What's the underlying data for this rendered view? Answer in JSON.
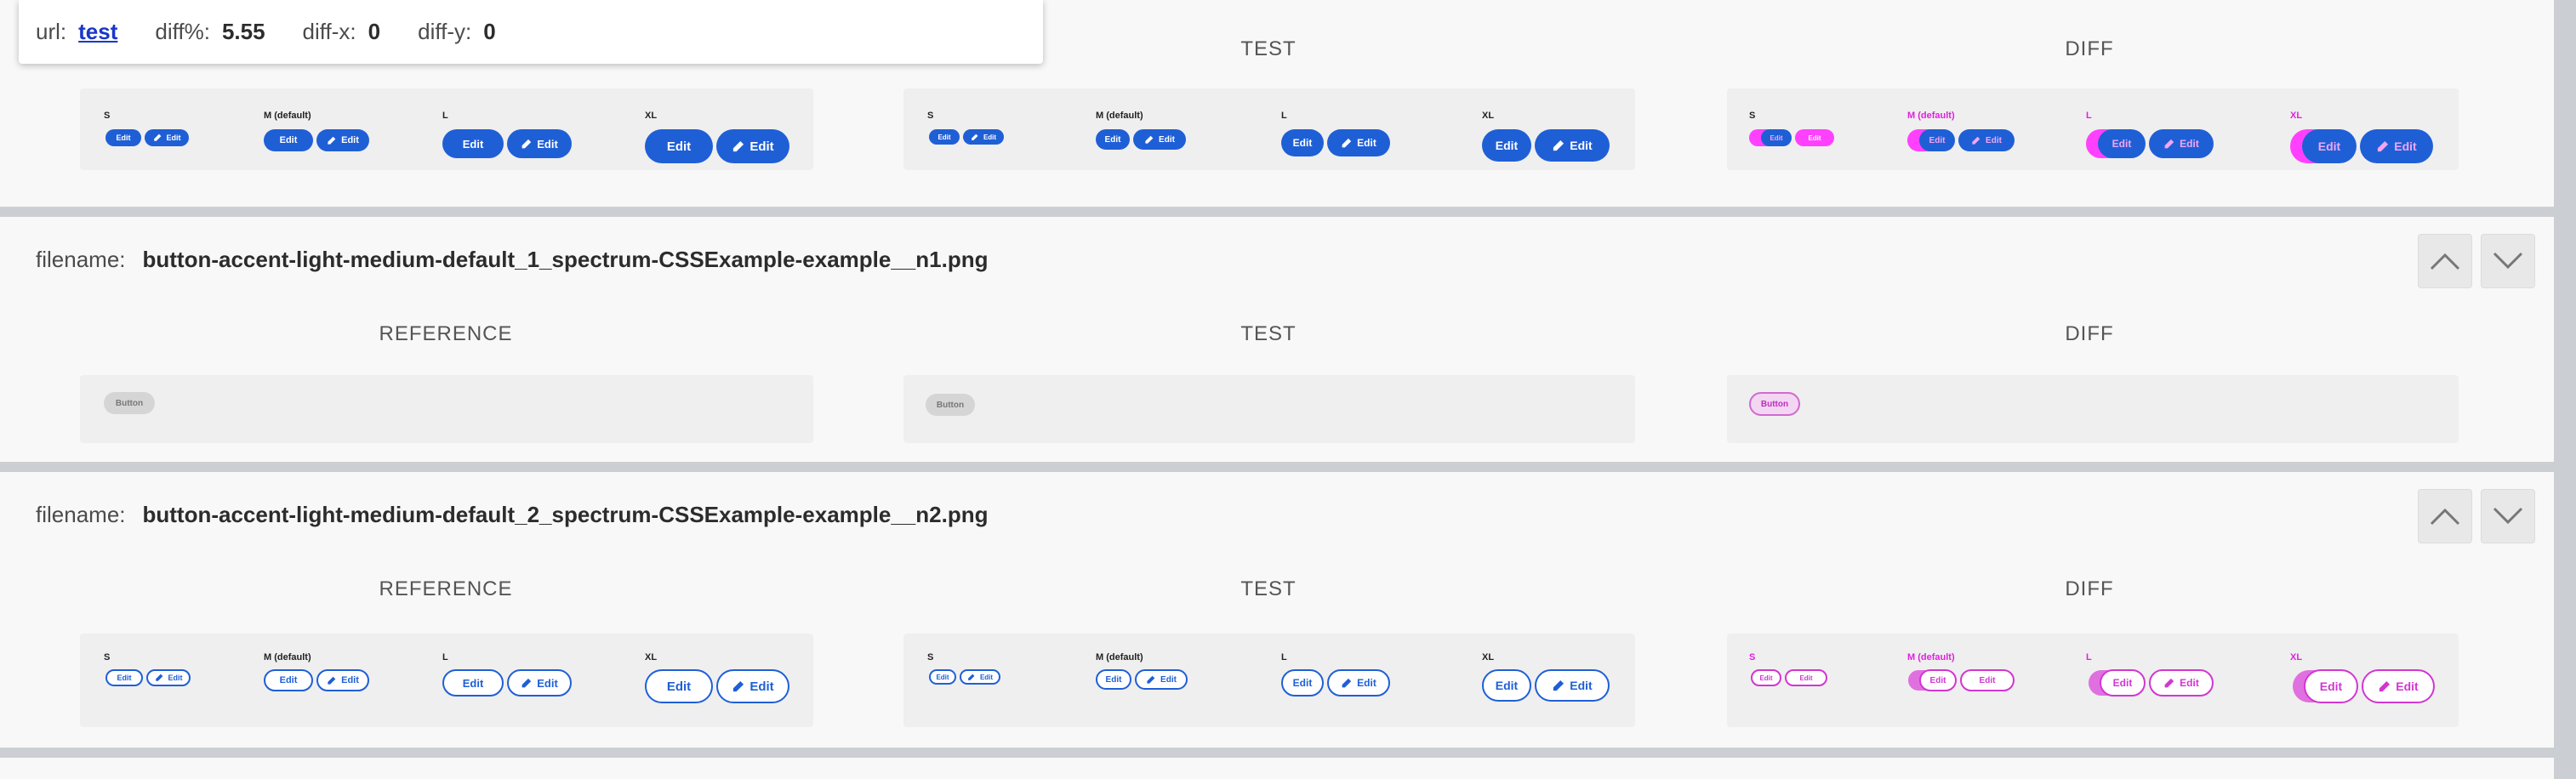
{
  "overlay": {
    "url_label": "url:",
    "url_link": "test",
    "diff_label": "diff%:",
    "diff_value": "5.55",
    "diffx_label": "diff-x:",
    "diffx_value": "0",
    "diffy_label": "diff-y:",
    "diffy_value": "0"
  },
  "headings": {
    "reference": "REFERENCE",
    "test": "TEST",
    "diff": "DIFF"
  },
  "sizes": {
    "s": "S",
    "m": "M (default)",
    "l": "L",
    "xl": "XL"
  },
  "button_labels": {
    "edit": "Edit",
    "button": "Button"
  },
  "sections": [
    {
      "filename_label": "filename:",
      "filename": "button-accent-light-medium-default_1_spectrum-CSSExample-example__n1.png"
    },
    {
      "filename_label": "filename:",
      "filename": "button-accent-light-medium-default_2_spectrum-CSSExample-example__n2.png"
    }
  ],
  "colors": {
    "accent": "#1f5fd6",
    "diff_magenta": "#ff40ff",
    "background": "#f8f8f8"
  },
  "icons": [
    "chevron-up-icon",
    "chevron-down-icon",
    "pencil-icon"
  ]
}
